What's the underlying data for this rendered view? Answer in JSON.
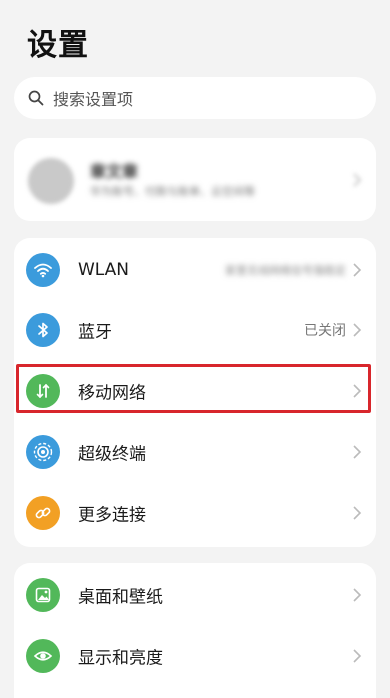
{
  "page": {
    "title": "设置"
  },
  "search": {
    "placeholder": "搜索设置项"
  },
  "account": {
    "name": "章文章",
    "subtitle": "华为账号、付款与账单、云空间等"
  },
  "connections": {
    "items": [
      {
        "label": "WLAN",
        "value": "家里无线网络信号强稳定",
        "icon": "wifi-icon",
        "icon_color": "#3b9bdc"
      },
      {
        "label": "蓝牙",
        "value": "已关闭",
        "icon": "bluetooth-icon",
        "icon_color": "#3b9bdc"
      },
      {
        "label": "移动网络",
        "value": "",
        "icon": "mobile-data-icon",
        "icon_color": "#52b85a"
      },
      {
        "label": "超级终端",
        "value": "",
        "icon": "super-device-icon",
        "icon_color": "#3b9bdc"
      },
      {
        "label": "更多连接",
        "value": "",
        "icon": "link-icon",
        "icon_color": "#f2a024"
      }
    ]
  },
  "display": {
    "items": [
      {
        "label": "桌面和壁纸",
        "icon": "wallpaper-icon",
        "icon_color": "#52b85a"
      },
      {
        "label": "显示和亮度",
        "icon": "eye-icon",
        "icon_color": "#52b85a"
      }
    ]
  },
  "colors": {
    "highlight": "#d8262c",
    "background": "#f3f3f3"
  }
}
